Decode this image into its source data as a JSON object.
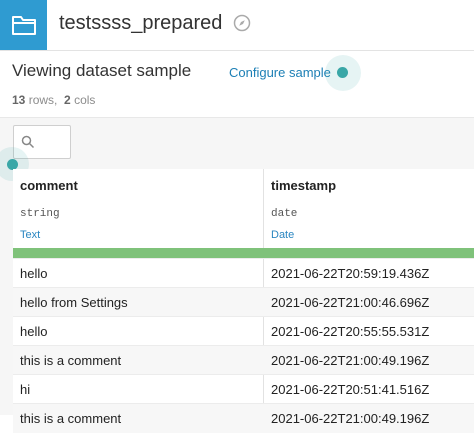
{
  "header": {
    "dataset_name": "testssss_prepared",
    "folder_icon": "folder-icon",
    "compass_icon": "compass-icon",
    "accent_color": "#2f9bd1"
  },
  "sample": {
    "title": "Viewing dataset sample",
    "configure_link": "Configure sample",
    "rows_count": "13",
    "rows_label": "rows,",
    "cols_count": "2",
    "cols_label": "cols"
  },
  "search": {
    "icon": "search-icon",
    "placeholder": ""
  },
  "columns": [
    {
      "name": "comment",
      "storage_type": "string",
      "meaning": "Text"
    },
    {
      "name": "timestamp",
      "storage_type": "date",
      "meaning": "Date"
    }
  ],
  "rows": [
    [
      "hello",
      "2021-06-22T20:59:19.436Z"
    ],
    [
      "hello from Settings",
      "2021-06-22T21:00:46.696Z"
    ],
    [
      "hello",
      "2021-06-22T20:55:55.531Z"
    ],
    [
      "this is a comment",
      "2021-06-22T21:00:49.196Z"
    ],
    [
      "hi",
      "2021-06-22T20:51:41.516Z"
    ],
    [
      "this is a comment",
      "2021-06-22T21:00:49.196Z"
    ]
  ]
}
